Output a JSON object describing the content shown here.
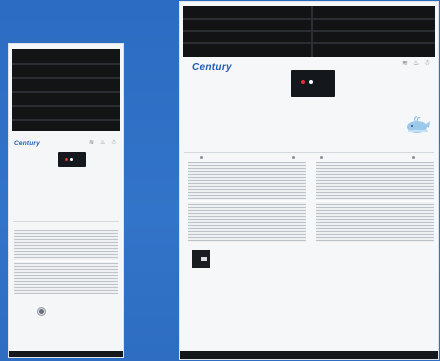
{
  "scene": {
    "background_color": "#2f6fc4",
    "brand_color": "#1f5bb5"
  },
  "units": {
    "small": {
      "brand_logo": "Century",
      "panel_icons": [
        "≋",
        "♨",
        "☃"
      ]
    },
    "large": {
      "brand_logo": "Century",
      "panel_icons": [
        "≋",
        "♨",
        "☃"
      ]
    }
  }
}
